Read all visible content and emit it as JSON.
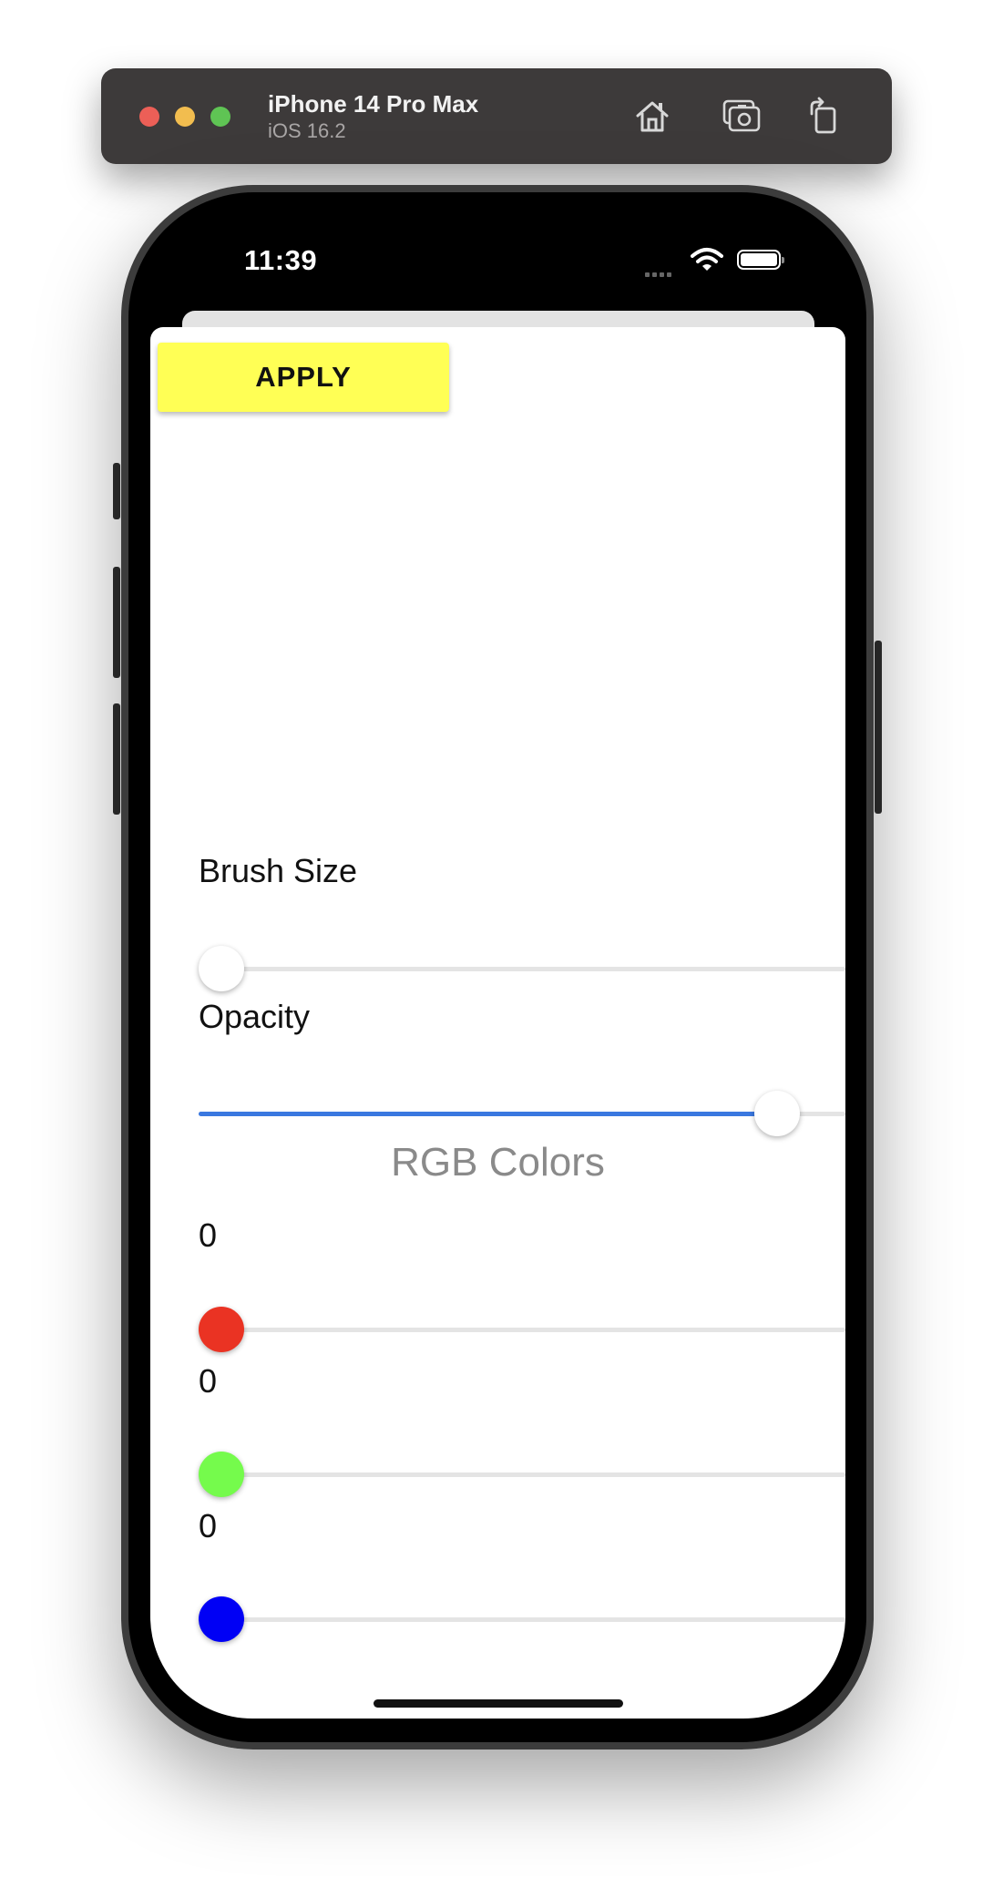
{
  "simulator": {
    "device_name": "iPhone 14 Pro Max",
    "os_version": "iOS 16.2",
    "icons": [
      "home-icon",
      "screenshot-icon",
      "rotate-icon"
    ]
  },
  "status_bar": {
    "time": "11:39",
    "icons": [
      "cellular-signal-icon",
      "wifi-icon",
      "battery-icon"
    ]
  },
  "app": {
    "apply_label": "APPLY",
    "brush_size": {
      "label": "Brush Size",
      "value": 0.0
    },
    "opacity": {
      "label": "Opacity",
      "value": 1.0
    },
    "rgb_title": "RGB Colors",
    "red": {
      "value": "0",
      "position": 0.0,
      "color": "#ea3323"
    },
    "green": {
      "value": "0",
      "position": 0.0,
      "color": "#75fb4c"
    },
    "blue": {
      "value": "0",
      "position": 0.0,
      "color": "#0000f5"
    }
  },
  "colors": {
    "apply_bg": "#ffff55",
    "slider_active": "#3a78e0",
    "slider_track": "#e4e4e4"
  }
}
